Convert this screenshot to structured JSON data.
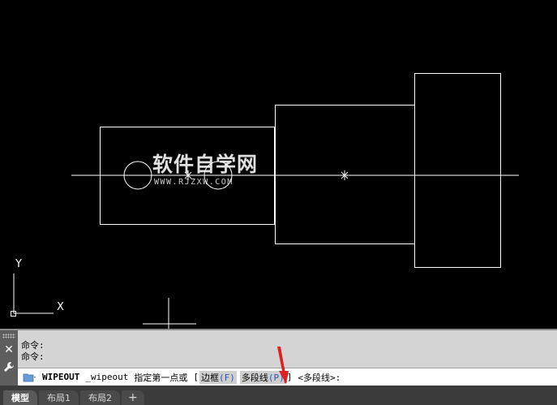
{
  "app": {
    "watermark_title": "软件自学网",
    "watermark_url": "WWW.RJZXW.COM"
  },
  "ucs": {
    "y_label": "Y",
    "x_label": "X"
  },
  "command": {
    "history": [
      "命令:",
      "命令:"
    ],
    "name": "WIPEOUT",
    "arg": "_wipeout",
    "prompt": "指定第一点或",
    "bracket_open": "[",
    "opt1_label": "边框",
    "opt1_key": "(F)",
    "opt2_label": "多段线",
    "opt2_key": "(P)",
    "bracket_close": "]",
    "default": "<多段线>:"
  },
  "tabs": [
    {
      "label": "模型",
      "active": true
    },
    {
      "label": "布局1",
      "active": false
    },
    {
      "label": "布局2",
      "active": false
    }
  ],
  "tab_add": "+",
  "colors": {
    "drawing_bg": "#000000",
    "line": "#ffffff",
    "option_key": "#2b57b5",
    "annotation_arrow": "#e02020"
  },
  "icons": {
    "close": "close-icon",
    "wrench": "wrench-icon",
    "command_folder": "folder-icon",
    "dropdown": "chevron-down-icon"
  }
}
